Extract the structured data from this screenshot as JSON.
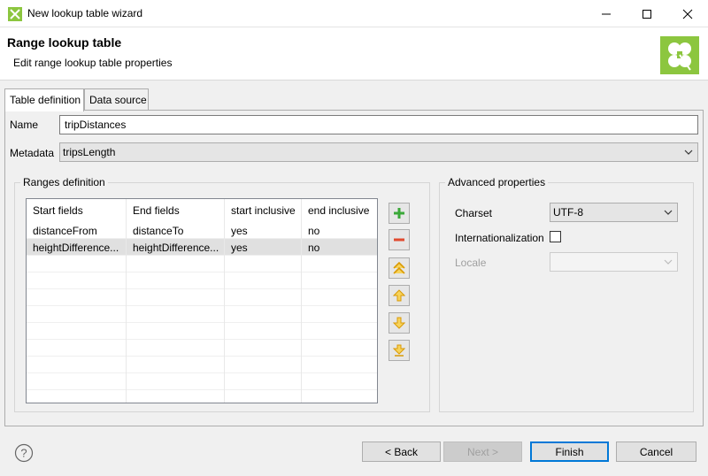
{
  "window": {
    "title": "New lookup table wizard",
    "controls": [
      "minimize-icon",
      "maximize-icon",
      "close-icon"
    ]
  },
  "header": {
    "title": "Range lookup table",
    "subtitle": "Edit range lookup table properties",
    "logo_color": "#8cc63f"
  },
  "tabs": [
    {
      "label": "Table definition",
      "active": true
    },
    {
      "label": "Data source",
      "active": false
    }
  ],
  "form": {
    "name_label": "Name",
    "name_value": "tripDistances",
    "metadata_label": "Metadata",
    "metadata_value": "tripsLength"
  },
  "ranges": {
    "group_title": "Ranges definition",
    "columns": [
      "Start fields",
      "End fields",
      "start inclusive",
      "end inclusive"
    ],
    "rows": [
      [
        "distanceFrom",
        "distanceTo",
        "yes",
        "no"
      ],
      [
        "heightDifference...",
        "heightDifference...",
        "yes",
        "no"
      ]
    ],
    "selected_row": 1,
    "side_buttons": [
      "add-icon",
      "remove-icon",
      "move-top-icon",
      "move-up-icon",
      "move-down-icon",
      "move-bottom-icon"
    ]
  },
  "advanced": {
    "group_title": "Advanced properties",
    "charset_label": "Charset",
    "charset_value": "UTF-8",
    "internationalization_label": "Internationalization",
    "internationalization_checked": false,
    "locale_label": "Locale",
    "locale_value": ""
  },
  "footer": {
    "back_label": "< Back",
    "next_label": "Next >",
    "finish_label": "Finish",
    "cancel_label": "Cancel"
  },
  "colors": {
    "accent": "#0078d7",
    "logo": "#8cc63f"
  }
}
